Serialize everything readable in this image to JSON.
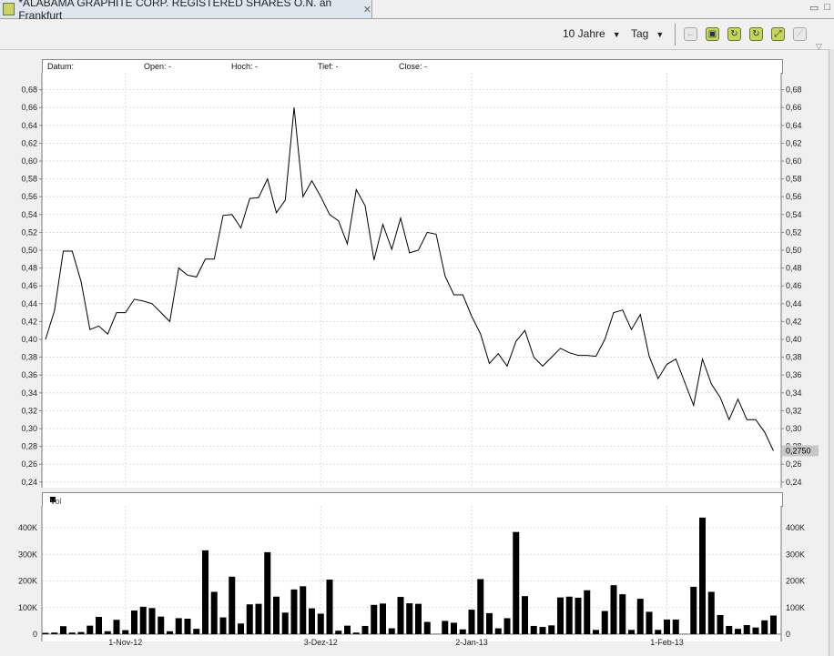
{
  "tab": {
    "title": "*ALABAMA GRAPHITE CORP. REGISTERED SHARES O.N. an Frankfurt",
    "icon": "chart-icon",
    "close_icon": "close-icon"
  },
  "window": {
    "minimize": "▭",
    "maximize": "□"
  },
  "toolbar": {
    "range": "10 Jahre",
    "interval": "Tag",
    "buttons": [
      "back-icon",
      "save-icon",
      "refresh-icon",
      "reload-icon",
      "expand-icon",
      "chart-type-icon"
    ]
  },
  "info": {
    "datum": "Datum:",
    "open": "Open: -",
    "hoch": "Hoch: -",
    "tief": "Tief: -",
    "close": "Close: -"
  },
  "volume_header": "Vol",
  "chart_data": [
    {
      "type": "line",
      "ylim": [
        0.24,
        0.68
      ],
      "yticks": [
        "0,68",
        "0,66",
        "0,64",
        "0,62",
        "0,60",
        "0,58",
        "0,56",
        "0,54",
        "0,52",
        "0,50",
        "0,48",
        "0,46",
        "0,44",
        "0,42",
        "0,40",
        "0,38",
        "0,36",
        "0,34",
        "0,32",
        "0,30",
        "0,28",
        "0,26",
        "0,24"
      ],
      "grid": true,
      "last_value_label": "0,2750",
      "values": [
        0.4,
        0.432,
        0.499,
        0.499,
        0.465,
        0.411,
        0.415,
        0.406,
        0.43,
        0.43,
        0.445,
        0.443,
        0.44,
        0.43,
        0.42,
        0.48,
        0.472,
        0.47,
        0.49,
        0.49,
        0.539,
        0.54,
        0.525,
        0.558,
        0.559,
        0.58,
        0.542,
        0.556,
        0.66,
        0.56,
        0.578,
        0.56,
        0.54,
        0.533,
        0.507,
        0.568,
        0.55,
        0.489,
        0.529,
        0.501,
        0.536,
        0.497,
        0.5,
        0.52,
        0.518,
        0.471,
        0.45,
        0.45,
        0.426,
        0.406,
        0.373,
        0.384,
        0.37,
        0.398,
        0.41,
        0.38,
        0.37,
        0.38,
        0.39,
        0.385,
        0.382,
        0.382,
        0.381,
        0.4,
        0.43,
        0.433,
        0.411,
        0.428,
        0.381,
        0.356,
        0.372,
        0.378,
        0.352,
        0.326,
        0.378,
        0.35,
        0.335,
        0.31,
        0.333,
        0.31,
        0.31,
        0.296,
        0.275
      ]
    },
    {
      "type": "bar",
      "series": [
        {
          "name": "Vol",
          "values": [
            5000,
            6000,
            30000,
            6000,
            8000,
            32000,
            65000,
            11000,
            54000,
            15000,
            89000,
            103000,
            98000,
            66000,
            11000,
            60000,
            58000,
            20000,
            315000,
            159000,
            63000,
            216000,
            40000,
            112000,
            114000,
            308000,
            141000,
            81000,
            168000,
            180000,
            97000,
            77000,
            205000,
            13000,
            32000,
            6000,
            31000,
            110000,
            115000,
            22000,
            140000,
            116000,
            114000,
            46000,
            3000,
            50000,
            43000,
            18000,
            92000,
            207000,
            79000,
            22000,
            60000,
            384000,
            143000,
            31000,
            27000,
            33000,
            138000,
            141000,
            137000,
            165000,
            16000,
            87000,
            184000,
            150000,
            16000,
            133000,
            84000,
            16000,
            55000,
            55000,
            3000,
            178000,
            438000,
            159000,
            72000,
            31000,
            20000,
            34000,
            25000,
            52000,
            70000
          ]
        }
      ],
      "ylim": [
        0,
        480000
      ],
      "yticks": [
        "0",
        "100K",
        "200K",
        "300K",
        "400K"
      ],
      "grid": true,
      "xticks": [
        {
          "label": "1-Nov-12",
          "index": 9
        },
        {
          "label": "3-Dez-12",
          "index": 31
        },
        {
          "label": "2-Jan-13",
          "index": 48
        },
        {
          "label": "1-Feb-13",
          "index": 70
        }
      ]
    }
  ]
}
